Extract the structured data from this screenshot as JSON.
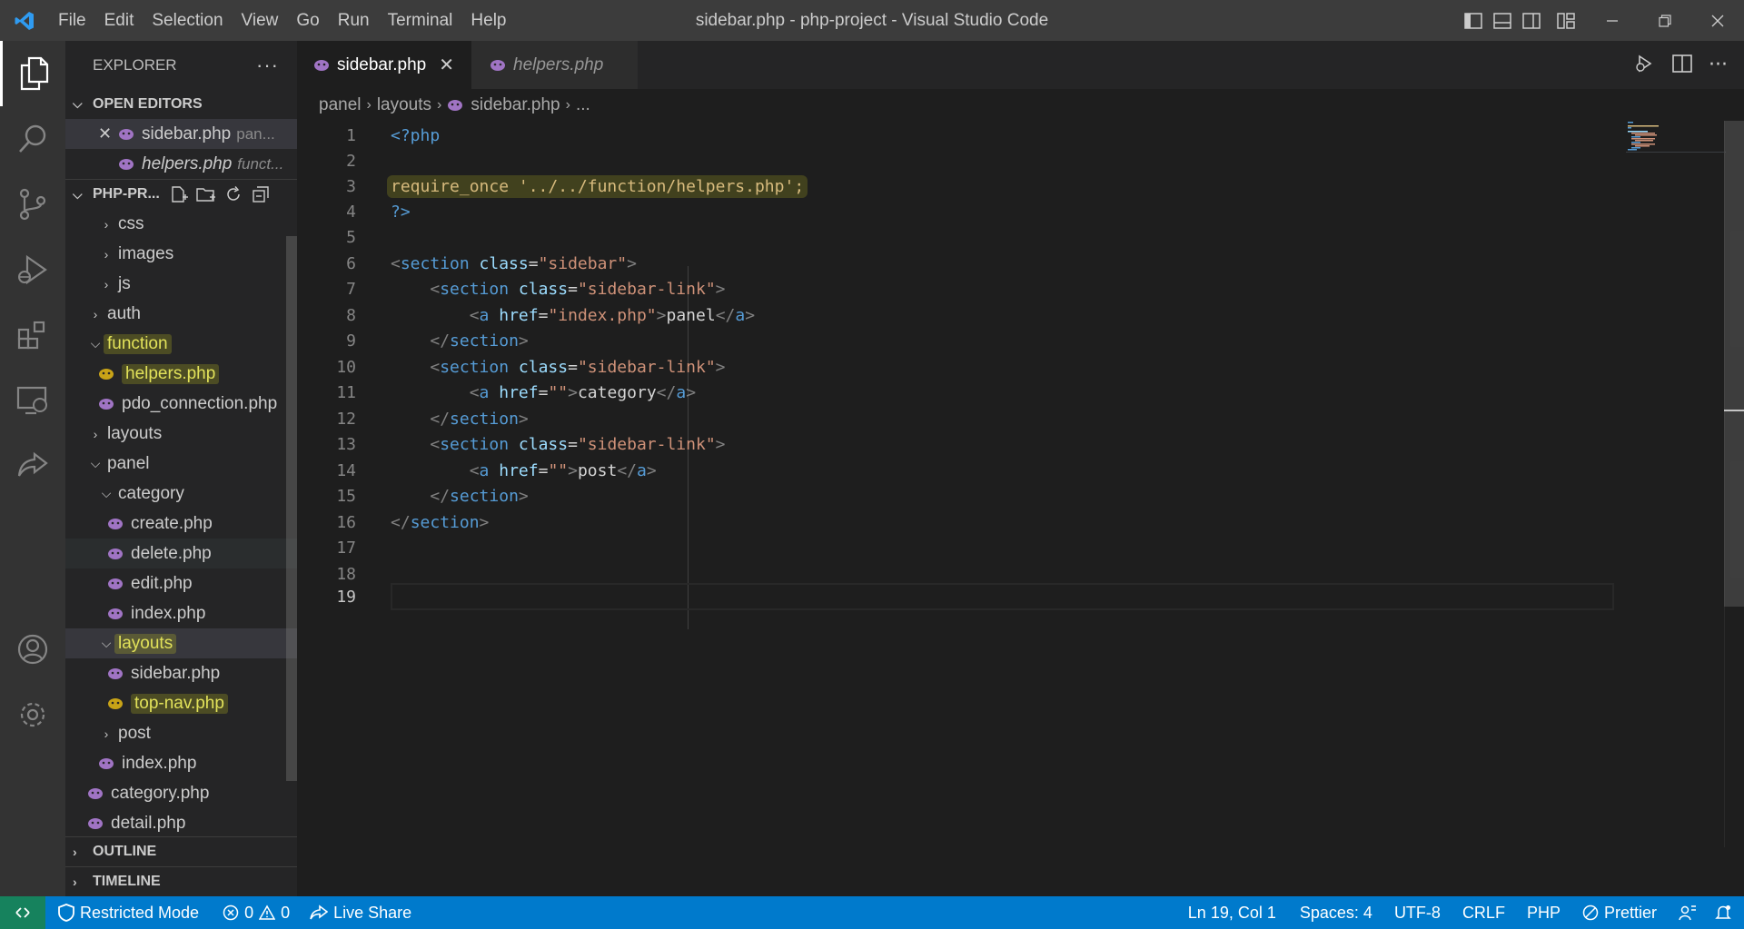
{
  "window": {
    "title": "sidebar.php - php-project - Visual Studio Code"
  },
  "menu": [
    "File",
    "Edit",
    "Selection",
    "View",
    "Go",
    "Run",
    "Terminal",
    "Help"
  ],
  "explorer": {
    "header": "EXPLORER",
    "open_editors_label": "OPEN EDITORS",
    "open_editors": [
      {
        "name": "sidebar.php",
        "path": "pan..."
      },
      {
        "name": "helpers.php",
        "path": "funct..."
      }
    ],
    "project_label": "PHP-PR...",
    "tree": [
      {
        "label": "css",
        "kind": "folder",
        "state": "collapsed"
      },
      {
        "label": "images",
        "kind": "folder",
        "state": "collapsed"
      },
      {
        "label": "js",
        "kind": "folder",
        "state": "collapsed"
      },
      {
        "label": "auth",
        "kind": "folder",
        "state": "collapsed"
      },
      {
        "label": "function",
        "kind": "folder",
        "state": "expanded",
        "highlight": true
      },
      {
        "label": "helpers.php",
        "kind": "php",
        "highlight": true
      },
      {
        "label": "pdo_connection.php",
        "kind": "php"
      },
      {
        "label": "layouts",
        "kind": "folder",
        "state": "collapsed"
      },
      {
        "label": "panel",
        "kind": "folder",
        "state": "expanded"
      },
      {
        "label": "category",
        "kind": "folder",
        "state": "expanded"
      },
      {
        "label": "create.php",
        "kind": "php"
      },
      {
        "label": "delete.php",
        "kind": "php"
      },
      {
        "label": "edit.php",
        "kind": "php"
      },
      {
        "label": "index.php",
        "kind": "php"
      },
      {
        "label": "layouts",
        "kind": "folder",
        "state": "expanded",
        "highlight": true
      },
      {
        "label": "sidebar.php",
        "kind": "php"
      },
      {
        "label": "top-nav.php",
        "kind": "php",
        "highlight": true
      },
      {
        "label": "post",
        "kind": "folder",
        "state": "collapsed"
      },
      {
        "label": "index.php",
        "kind": "php"
      },
      {
        "label": "category.php",
        "kind": "php"
      },
      {
        "label": "detail.php",
        "kind": "php"
      }
    ],
    "outline_label": "OUTLINE",
    "timeline_label": "TIMELINE"
  },
  "tabs": [
    {
      "label": "sidebar.php"
    },
    {
      "label": "helpers.php"
    }
  ],
  "breadcrumb": [
    "panel",
    "layouts",
    "sidebar.php",
    "..."
  ],
  "code_lines": [
    "1",
    "2",
    "3",
    "4",
    "5",
    "6",
    "7",
    "8",
    "9",
    "10",
    "11",
    "12",
    "13",
    "14",
    "15",
    "16",
    "17",
    "18",
    "19"
  ],
  "code": {
    "l1": "<?php",
    "l3": "require_once '../../function/helpers.php';",
    "l4": "?>",
    "sidebar_class": "\"sidebar\"",
    "sidebar_link_class": "\"sidebar-link\"",
    "href_index": "\"index.php\"",
    "href_empty": "\"\"",
    "link_panel": "panel",
    "link_category": "category",
    "link_post": "post"
  },
  "status": {
    "restricted": "Restricted Mode",
    "errors": "0",
    "warnings": "0",
    "live_share": "Live Share",
    "position": "Ln 19, Col 1",
    "spaces": "Spaces: 4",
    "encoding": "UTF-8",
    "eol": "CRLF",
    "language": "PHP",
    "prettier": "Prettier"
  },
  "colors": {
    "accent": "#007acc",
    "remote": "#16825d",
    "php_icon": "#a074c4",
    "php_icon_highlight": "#c8a317"
  }
}
